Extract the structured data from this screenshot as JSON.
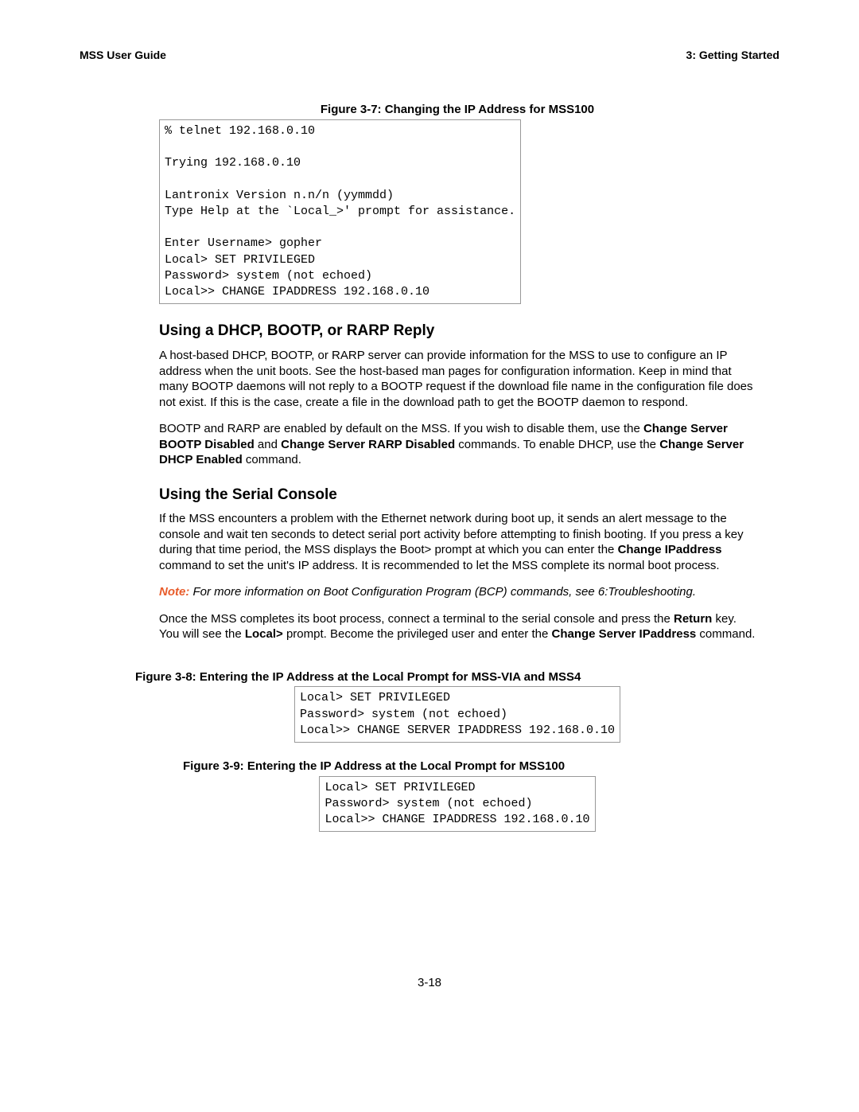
{
  "header": {
    "left": "MSS User Guide",
    "right": "3:  Getting Started"
  },
  "figures": {
    "f37": {
      "title": "Figure 3-7: Changing the IP Address for MSS100",
      "code": "% telnet 192.168.0.10\n\nTrying 192.168.0.10\n\nLantronix Version n.n/n (yymmdd)\nType Help at the `Local_>' prompt for assistance.\n\nEnter Username> gopher\nLocal> SET PRIVILEGED\nPassword> system (not echoed)\nLocal>> CHANGE IPADDRESS 192.168.0.10           "
    },
    "f38": {
      "title": "Figure 3-8: Entering the IP Address at the Local Prompt for MSS-VIA and MSS4",
      "code": "Local> SET PRIVILEGED\nPassword> system (not echoed)\nLocal>> CHANGE SERVER IPADDRESS 192.168.0.10"
    },
    "f39": {
      "title": "Figure 3-9: Entering the IP Address at the Local Prompt for MSS100",
      "code": "Local> SET PRIVILEGED\nPassword> system (not echoed)\nLocal>> CHANGE IPADDRESS 192.168.0.10"
    }
  },
  "sections": {
    "dhcp": {
      "heading": "Using a DHCP, BOOTP, or RARP Reply",
      "p1": "A host-based DHCP, BOOTP, or RARP server can provide information for the MSS to use to configure an IP address when the unit boots. See the host-based man pages for configuration information. Keep in mind that many BOOTP daemons will not reply to a BOOTP request if the download file name in the configuration file does not exist. If this is the case, create a file in the download path to get the BOOTP daemon to respond.",
      "p2a": "BOOTP and RARP are enabled by default on the MSS. If you wish to disable them, use the ",
      "p2b1": "Change Server BOOTP Disabled",
      "p2c": " and ",
      "p2b2": "Change Server RARP Disabled",
      "p2d": " commands. To enable DHCP, use the ",
      "p2b3": "Change Server DHCP Enabled",
      "p2e": " command."
    },
    "serial": {
      "heading": "Using the Serial Console",
      "p1a": "If the MSS encounters a problem with the Ethernet network during boot up, it sends an alert message to the console and wait ten seconds to detect serial port activity before attempting to finish booting. If you press a key during that time period, the MSS displays the Boot> prompt at which you can enter the ",
      "p1b1": "Change IPaddress",
      "p1c": " command to set the unit's IP address.  It is recommended to let the MSS complete its normal boot process.",
      "note_label": "Note:",
      "note_text": " For more information on Boot Configuration Program (BCP) commands, see 6:Troubleshooting.",
      "p3a": "Once the MSS completes its boot process, connect a terminal to the serial console and press the ",
      "p3b1": "Return",
      "p3c": " key. You will see the ",
      "p3b2": "Local>",
      "p3d": " prompt. Become the privileged user and enter the ",
      "p3b3": "Change Server IPaddress",
      "p3e": " command."
    }
  },
  "page_number": "3-18"
}
